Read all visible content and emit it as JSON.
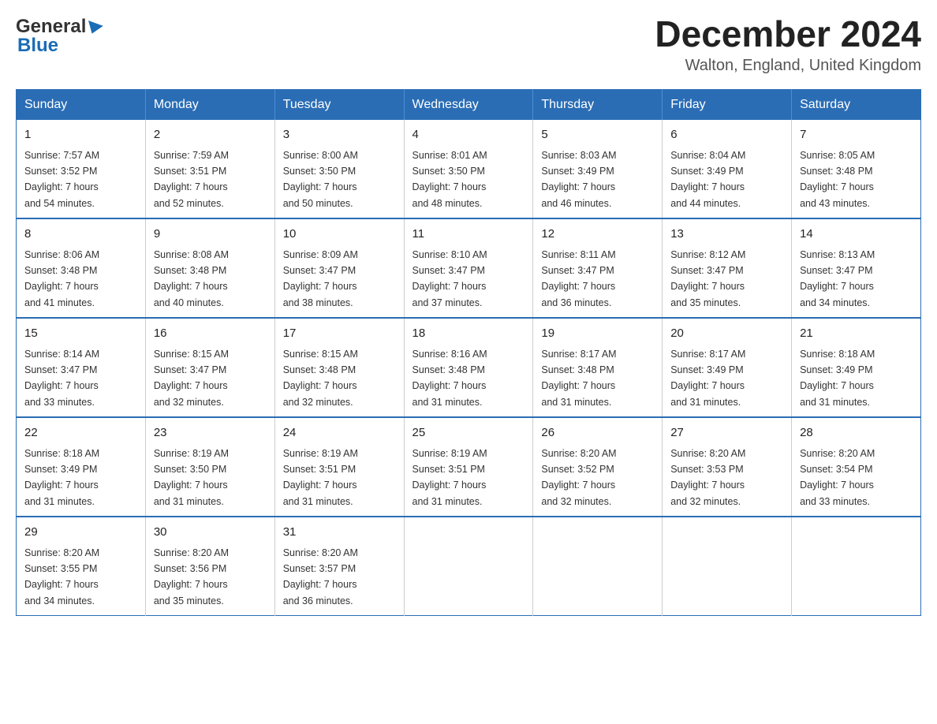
{
  "header": {
    "logo_general": "General",
    "logo_blue": "Blue",
    "month_title": "December 2024",
    "location": "Walton, England, United Kingdom"
  },
  "days_of_week": [
    "Sunday",
    "Monday",
    "Tuesday",
    "Wednesday",
    "Thursday",
    "Friday",
    "Saturday"
  ],
  "weeks": [
    [
      {
        "day": "1",
        "sunrise": "7:57 AM",
        "sunset": "3:52 PM",
        "daylight": "7 hours and 54 minutes."
      },
      {
        "day": "2",
        "sunrise": "7:59 AM",
        "sunset": "3:51 PM",
        "daylight": "7 hours and 52 minutes."
      },
      {
        "day": "3",
        "sunrise": "8:00 AM",
        "sunset": "3:50 PM",
        "daylight": "7 hours and 50 minutes."
      },
      {
        "day": "4",
        "sunrise": "8:01 AM",
        "sunset": "3:50 PM",
        "daylight": "7 hours and 48 minutes."
      },
      {
        "day": "5",
        "sunrise": "8:03 AM",
        "sunset": "3:49 PM",
        "daylight": "7 hours and 46 minutes."
      },
      {
        "day": "6",
        "sunrise": "8:04 AM",
        "sunset": "3:49 PM",
        "daylight": "7 hours and 44 minutes."
      },
      {
        "day": "7",
        "sunrise": "8:05 AM",
        "sunset": "3:48 PM",
        "daylight": "7 hours and 43 minutes."
      }
    ],
    [
      {
        "day": "8",
        "sunrise": "8:06 AM",
        "sunset": "3:48 PM",
        "daylight": "7 hours and 41 minutes."
      },
      {
        "day": "9",
        "sunrise": "8:08 AM",
        "sunset": "3:48 PM",
        "daylight": "7 hours and 40 minutes."
      },
      {
        "day": "10",
        "sunrise": "8:09 AM",
        "sunset": "3:47 PM",
        "daylight": "7 hours and 38 minutes."
      },
      {
        "day": "11",
        "sunrise": "8:10 AM",
        "sunset": "3:47 PM",
        "daylight": "7 hours and 37 minutes."
      },
      {
        "day": "12",
        "sunrise": "8:11 AM",
        "sunset": "3:47 PM",
        "daylight": "7 hours and 36 minutes."
      },
      {
        "day": "13",
        "sunrise": "8:12 AM",
        "sunset": "3:47 PM",
        "daylight": "7 hours and 35 minutes."
      },
      {
        "day": "14",
        "sunrise": "8:13 AM",
        "sunset": "3:47 PM",
        "daylight": "7 hours and 34 minutes."
      }
    ],
    [
      {
        "day": "15",
        "sunrise": "8:14 AM",
        "sunset": "3:47 PM",
        "daylight": "7 hours and 33 minutes."
      },
      {
        "day": "16",
        "sunrise": "8:15 AM",
        "sunset": "3:47 PM",
        "daylight": "7 hours and 32 minutes."
      },
      {
        "day": "17",
        "sunrise": "8:15 AM",
        "sunset": "3:48 PM",
        "daylight": "7 hours and 32 minutes."
      },
      {
        "day": "18",
        "sunrise": "8:16 AM",
        "sunset": "3:48 PM",
        "daylight": "7 hours and 31 minutes."
      },
      {
        "day": "19",
        "sunrise": "8:17 AM",
        "sunset": "3:48 PM",
        "daylight": "7 hours and 31 minutes."
      },
      {
        "day": "20",
        "sunrise": "8:17 AM",
        "sunset": "3:49 PM",
        "daylight": "7 hours and 31 minutes."
      },
      {
        "day": "21",
        "sunrise": "8:18 AM",
        "sunset": "3:49 PM",
        "daylight": "7 hours and 31 minutes."
      }
    ],
    [
      {
        "day": "22",
        "sunrise": "8:18 AM",
        "sunset": "3:49 PM",
        "daylight": "7 hours and 31 minutes."
      },
      {
        "day": "23",
        "sunrise": "8:19 AM",
        "sunset": "3:50 PM",
        "daylight": "7 hours and 31 minutes."
      },
      {
        "day": "24",
        "sunrise": "8:19 AM",
        "sunset": "3:51 PM",
        "daylight": "7 hours and 31 minutes."
      },
      {
        "day": "25",
        "sunrise": "8:19 AM",
        "sunset": "3:51 PM",
        "daylight": "7 hours and 31 minutes."
      },
      {
        "day": "26",
        "sunrise": "8:20 AM",
        "sunset": "3:52 PM",
        "daylight": "7 hours and 32 minutes."
      },
      {
        "day": "27",
        "sunrise": "8:20 AM",
        "sunset": "3:53 PM",
        "daylight": "7 hours and 32 minutes."
      },
      {
        "day": "28",
        "sunrise": "8:20 AM",
        "sunset": "3:54 PM",
        "daylight": "7 hours and 33 minutes."
      }
    ],
    [
      {
        "day": "29",
        "sunrise": "8:20 AM",
        "sunset": "3:55 PM",
        "daylight": "7 hours and 34 minutes."
      },
      {
        "day": "30",
        "sunrise": "8:20 AM",
        "sunset": "3:56 PM",
        "daylight": "7 hours and 35 minutes."
      },
      {
        "day": "31",
        "sunrise": "8:20 AM",
        "sunset": "3:57 PM",
        "daylight": "7 hours and 36 minutes."
      },
      null,
      null,
      null,
      null
    ]
  ],
  "labels": {
    "sunrise": "Sunrise:",
    "sunset": "Sunset:",
    "daylight": "Daylight:"
  }
}
